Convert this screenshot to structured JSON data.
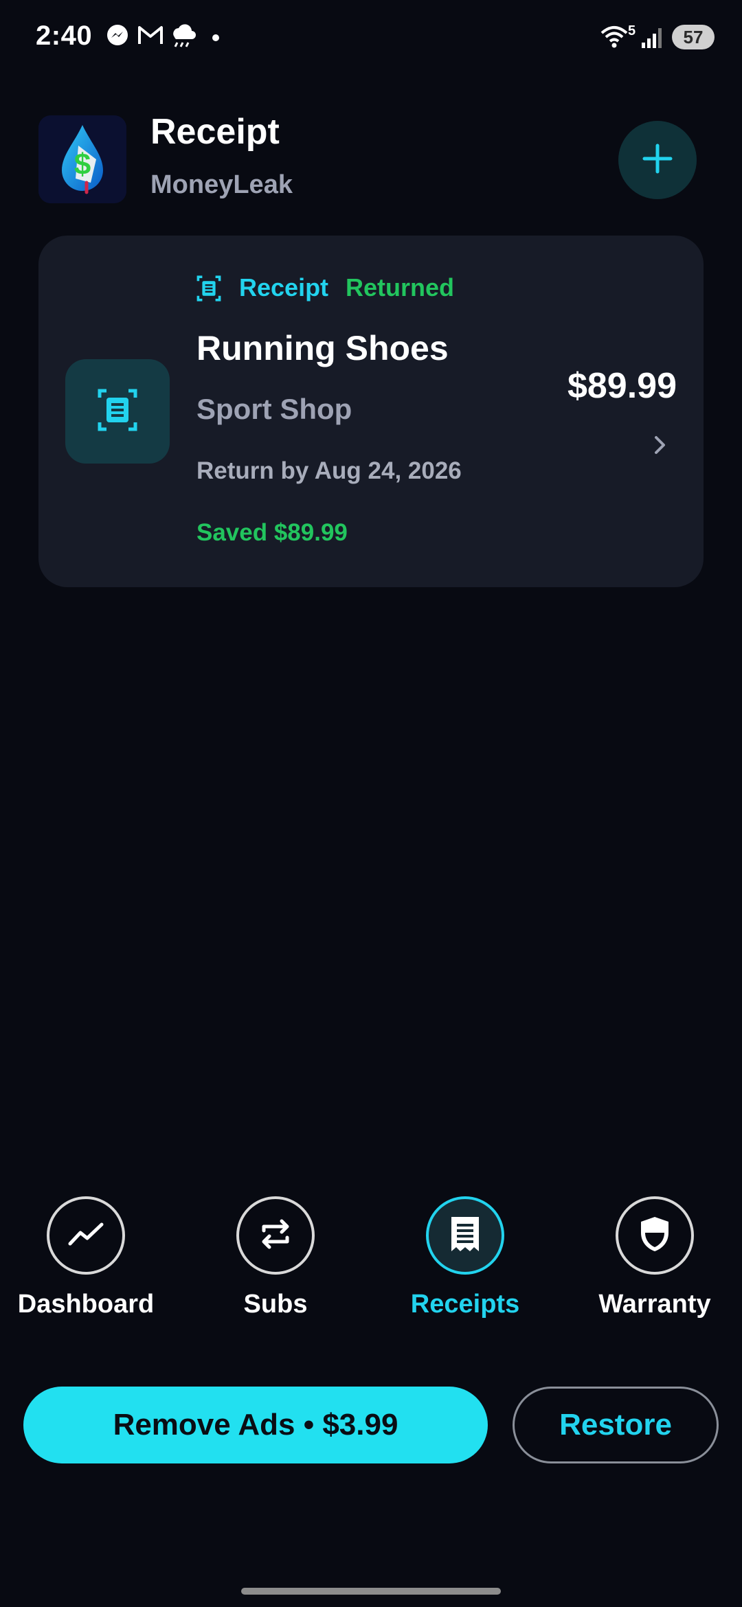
{
  "status_bar": {
    "time": "2:40",
    "wifi_label": "5",
    "battery": "57",
    "notification_icons": [
      "messenger-icon",
      "gmail-icon",
      "weather-icon",
      "dot-icon"
    ]
  },
  "header": {
    "title": "Receipt",
    "subtitle": "MoneyLeak",
    "add_button_icon": "plus-icon"
  },
  "receipt_card": {
    "type_label": "Receipt",
    "status_label": "Returned",
    "item_title": "Running Shoes",
    "merchant": "Sport Shop",
    "return_by": "Return by Aug 24, 2026",
    "saved": "Saved $89.99",
    "price": "$89.99"
  },
  "bottom_nav": {
    "items": [
      {
        "label": "Dashboard",
        "icon": "trend-icon",
        "active": false
      },
      {
        "label": "Subs",
        "icon": "repeat-icon",
        "active": false
      },
      {
        "label": "Receipts",
        "icon": "receipt-icon",
        "active": true
      },
      {
        "label": "Warranty",
        "icon": "shield-icon",
        "active": false
      }
    ]
  },
  "actions": {
    "remove_ads_label": "Remove Ads • $3.99",
    "restore_label": "Restore"
  },
  "colors": {
    "background": "#080a12",
    "card": "#171b27",
    "accent": "#22d3ee",
    "success": "#22c55e"
  }
}
